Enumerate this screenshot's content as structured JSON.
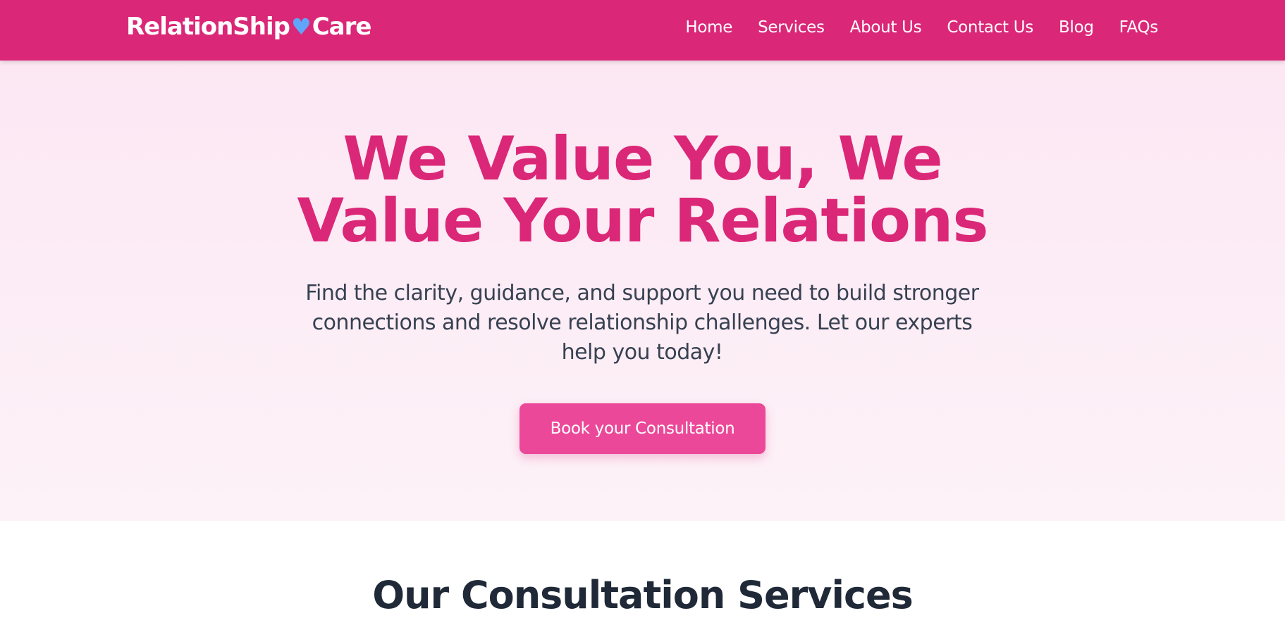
{
  "header": {
    "logo_left": "RelationShip",
    "logo_heart": "♥",
    "logo_right": "Care",
    "nav": [
      {
        "label": "Home"
      },
      {
        "label": "Services"
      },
      {
        "label": "About Us"
      },
      {
        "label": "Contact Us"
      },
      {
        "label": "Blog"
      },
      {
        "label": "FAQs"
      }
    ]
  },
  "hero": {
    "title_line1": "We Value You, We",
    "title_line2": "Value Your Relations",
    "subtitle": "Find the clarity, guidance, and support you need to build stronger connections and resolve relationship challenges. Let our experts help you today!",
    "cta_label": "Book your Consultation"
  },
  "services": {
    "title": "Our Consultation Services"
  },
  "colors": {
    "brand": "#db2777",
    "accent_heart": "#60a5fa",
    "button": "#ec4899",
    "hero_bg": "#fce7f3",
    "heading_dark": "#1f2937"
  },
  "icons": [
    "heart-icon"
  ]
}
